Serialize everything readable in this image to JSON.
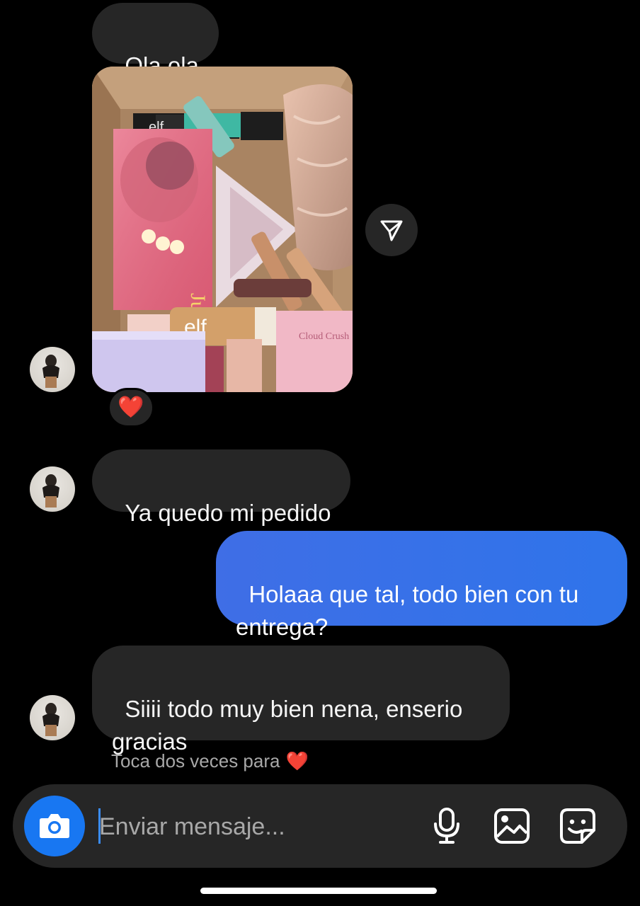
{
  "messages": [
    {
      "id": "m1",
      "sender": "them",
      "text": "Ola ola"
    },
    {
      "id": "m2",
      "sender": "them",
      "type": "photo",
      "reaction": "❤️"
    },
    {
      "id": "m3",
      "sender": "them",
      "text": "Ya quedo mi pedido"
    },
    {
      "id": "m4",
      "sender": "me",
      "text": "Holaaa que tal, todo bien con tu\nentrega?"
    },
    {
      "id": "m5",
      "sender": "them",
      "text": "Siiii todo muy bien nena, enserio\ngracias"
    }
  ],
  "hint": {
    "text": "Toca dos veces para",
    "emoji": "❤️"
  },
  "photo_labels": {
    "elf_top": "elf",
    "juvias": "Juvias",
    "elf_bottom": "elf",
    "cloud": "Cloud Crush"
  },
  "composer": {
    "placeholder": "Enviar mensaje...",
    "value": ""
  },
  "icons": {
    "camera": "camera-icon",
    "mic": "microphone-icon",
    "gallery": "image-gallery-icon",
    "sticker": "sticker-icon",
    "share": "paper-plane-icon"
  },
  "colors": {
    "background": "#000000",
    "incoming_bubble": "#262626",
    "outgoing_bubble": "#3770e8",
    "camera_button": "#1877f2",
    "muted_text": "#a8a8a8"
  }
}
